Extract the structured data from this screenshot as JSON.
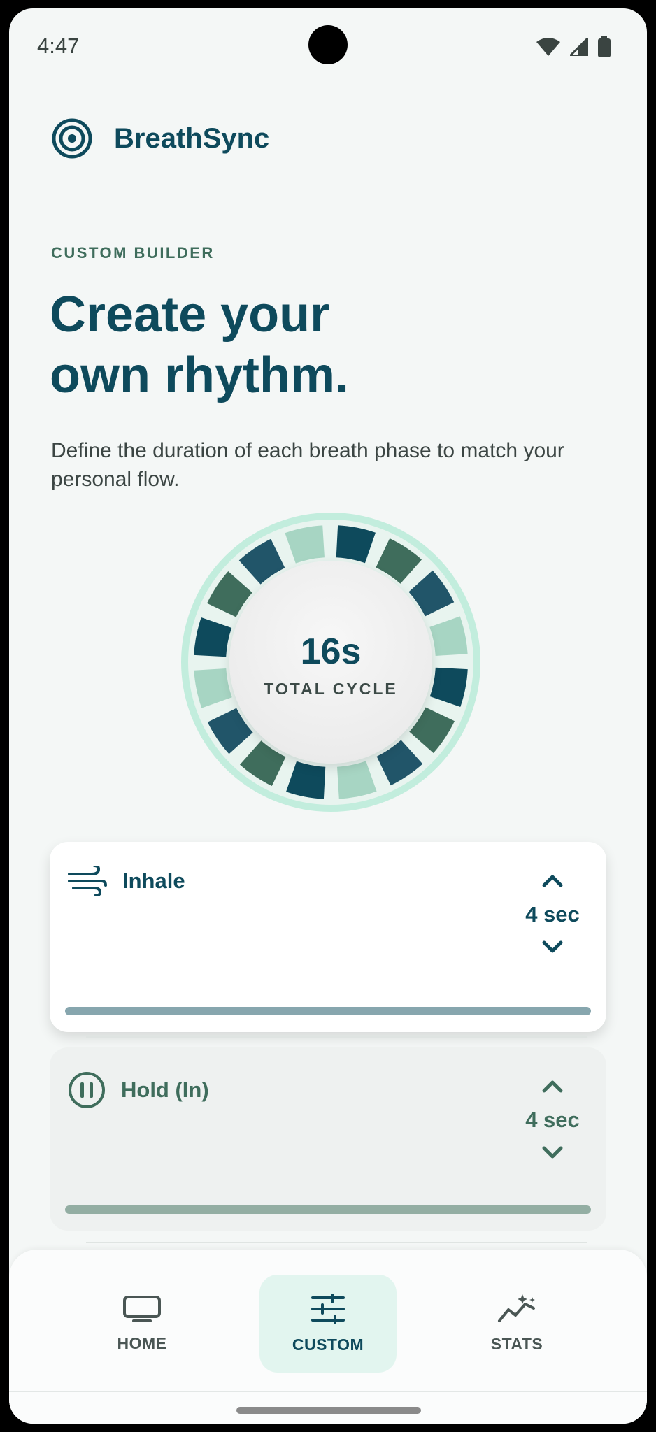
{
  "status_bar": {
    "time": "4:47"
  },
  "app": {
    "title": "BreathSync"
  },
  "header": {
    "eyebrow": "CUSTOM BUILDER",
    "headline_line1": "Create your",
    "headline_line2": "own rhythm.",
    "description": "Define the duration of each breath phase to match your personal flow."
  },
  "cycle": {
    "value": "16s",
    "label": "TOTAL CYCLE"
  },
  "phases": [
    {
      "name": "Inhale",
      "value": "4 sec",
      "icon": "wind-icon",
      "active": true
    },
    {
      "name": "Hold (In)",
      "value": "4 sec",
      "icon": "pause-circle-icon",
      "active": false
    }
  ],
  "nav": {
    "items": [
      {
        "label": "HOME",
        "icon": "tv-icon"
      },
      {
        "label": "CUSTOM",
        "icon": "sliders-icon",
        "selected": true
      },
      {
        "label": "STATS",
        "icon": "sparkline-icon"
      }
    ]
  },
  "colors": {
    "primary": "#0e4a5c",
    "secondary": "#3f6d5c",
    "ring_light": "#a7d5c3",
    "ring_outer": "#c2eddd",
    "background": "#f4f7f6"
  }
}
